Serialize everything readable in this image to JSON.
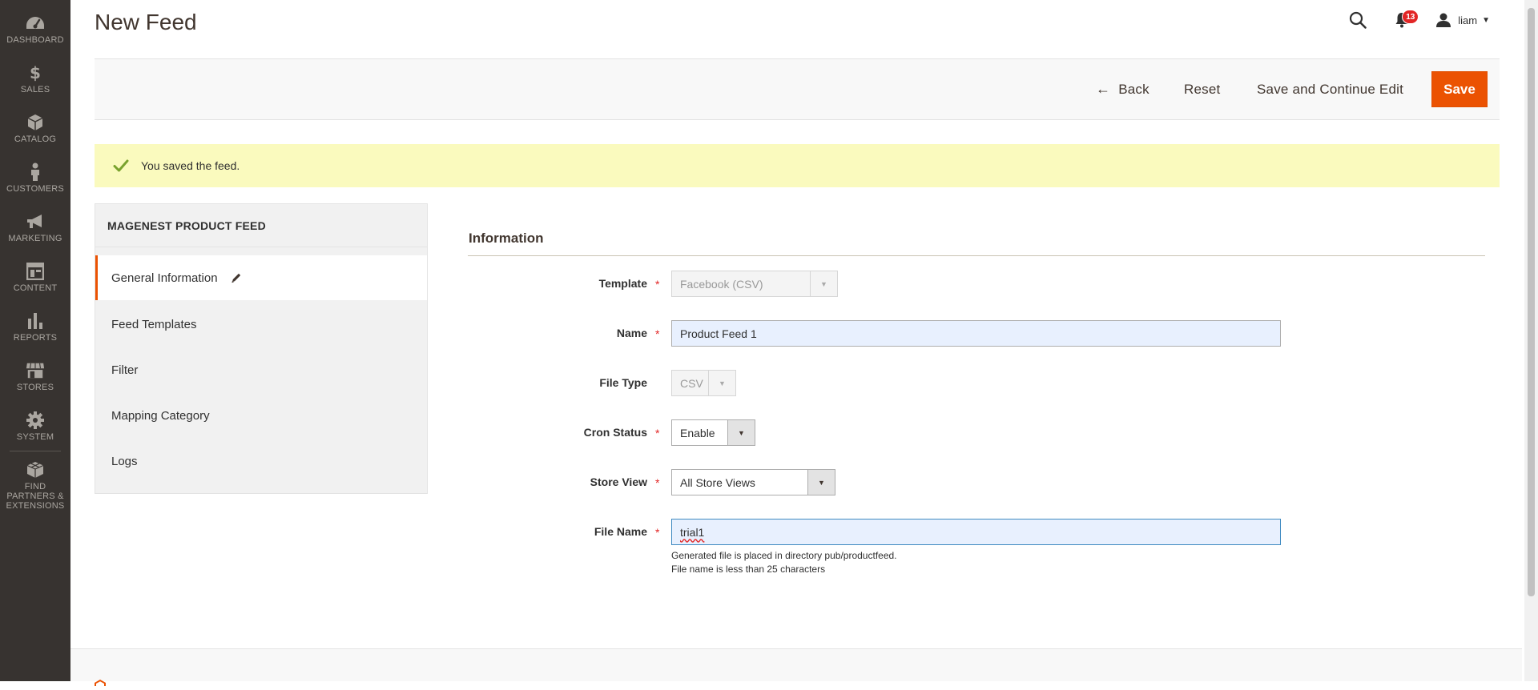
{
  "page": {
    "title": "New Feed"
  },
  "header": {
    "notification_count": "13",
    "user_name": "liam"
  },
  "menu": {
    "items": [
      {
        "key": "dashboard",
        "label": "DASHBOARD",
        "icon": "dashboard-icon"
      },
      {
        "key": "sales",
        "label": "SALES",
        "icon": "dollar-icon"
      },
      {
        "key": "catalog",
        "label": "CATALOG",
        "icon": "box-icon"
      },
      {
        "key": "customers",
        "label": "CUSTOMERS",
        "icon": "person-icon"
      },
      {
        "key": "marketing",
        "label": "MARKETING",
        "icon": "megaphone-icon"
      },
      {
        "key": "content",
        "label": "CONTENT",
        "icon": "layout-icon"
      },
      {
        "key": "reports",
        "label": "REPORTS",
        "icon": "bar-chart-icon"
      },
      {
        "key": "stores",
        "label": "STORES",
        "icon": "storefront-icon"
      },
      {
        "key": "system",
        "label": "SYSTEM",
        "icon": "gear-icon"
      },
      {
        "key": "partners",
        "label": "FIND PARTNERS & EXTENSIONS",
        "icon": "cubes-icon"
      }
    ]
  },
  "toolbar": {
    "back_label": "Back",
    "reset_label": "Reset",
    "save_continue_label": "Save and Continue Edit",
    "save_label": "Save",
    "save_color": "#eb5202"
  },
  "message": {
    "text": "You saved the feed.",
    "background": "#fafabe"
  },
  "side": {
    "heading": "MAGENEST PRODUCT FEED",
    "tabs": [
      {
        "label": "General Information",
        "active": true
      },
      {
        "label": "Feed Templates"
      },
      {
        "label": "Filter"
      },
      {
        "label": "Mapping Category"
      },
      {
        "label": "Logs"
      }
    ]
  },
  "form": {
    "section_title": "Information",
    "fields": {
      "template": {
        "label": "Template",
        "value": "Facebook (CSV)",
        "required": true
      },
      "name": {
        "label": "Name",
        "value": "Product Feed 1",
        "required": true
      },
      "file_type": {
        "label": "File Type",
        "value": "CSV",
        "required": false
      },
      "cron_status": {
        "label": "Cron Status",
        "value": "Enable",
        "required": true
      },
      "store_view": {
        "label": "Store View",
        "value": "All Store Views",
        "required": true
      },
      "file_name": {
        "label": "File Name",
        "value": "trial1",
        "required": true,
        "note_line1": "Generated file is placed in directory pub/productfeed.",
        "note_line2": "File name is less than 25 characters"
      }
    },
    "required_mark": "*"
  }
}
